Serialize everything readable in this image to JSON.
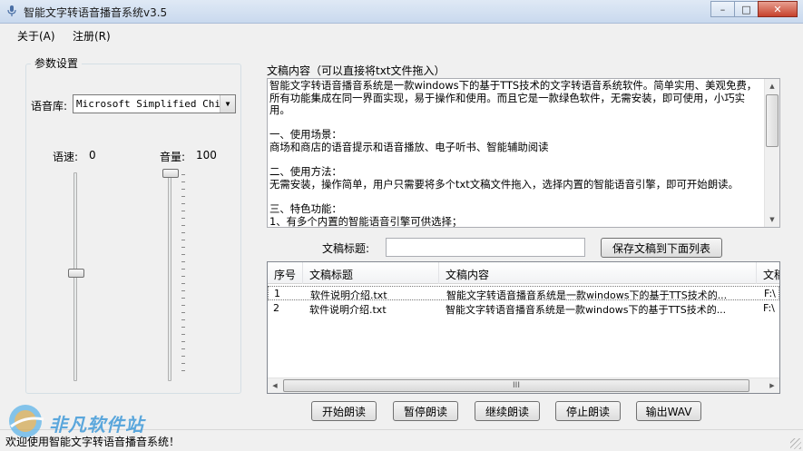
{
  "window": {
    "title": "智能文字转语音播音系统v3.5",
    "min_glyph": "–",
    "max_glyph": "□",
    "close_glyph": "✕"
  },
  "menu": {
    "about": "关于(A)",
    "register": "注册(R)"
  },
  "params": {
    "group_title": "参数设置",
    "voice_label": "语音库:",
    "voice_value": "Microsoft Simplified Chine",
    "speed_label": "语速:",
    "speed_value": "0",
    "volume_label": "音量:",
    "volume_value": "100",
    "speed_level_fraction": 0.5,
    "volume_level_fraction": 1.0
  },
  "editor": {
    "label": "文稿内容（可以直接将txt文件拖入）",
    "content": "智能文字转语音播音系统是一款windows下的基于TTS技术的文字转语音系统软件。简单实用、美观免费，所有功能集成在同一界面实现，易于操作和使用。而且它是一款绿色软件，无需安装，即可使用，小巧实用。\n\n一、使用场景：\n商场和商店的语音提示和语音播放、电子听书、智能辅助阅读\n\n二、使用方法：\n无需安装，操作简单，用户只需要将多个txt文稿文件拖入，选择内置的智能语音引擎，即可开始朗读。\n\n三、特色功能：\n1、有多个内置的智能语音引擎可供选择；"
  },
  "title_field": {
    "label": "文稿标题:",
    "value": "",
    "save_button": "保存文稿到下面列表"
  },
  "list": {
    "columns": [
      "序号",
      "文稿标题",
      "文稿内容",
      "文稿"
    ],
    "rows": [
      {
        "index": "1",
        "title": "软件说明介绍.txt",
        "content": "智能文字转语音播音系统是一款windows下的基于TTS技术的...",
        "path": "F:\\"
      },
      {
        "index": "2",
        "title": "软件说明介绍.txt",
        "content": "智能文字转语音播音系统是一款windows下的基于TTS技术的...",
        "path": "F:\\"
      }
    ],
    "scroll_grip": "III"
  },
  "buttons": {
    "start": "开始朗读",
    "pause": "暂停朗读",
    "resume": "继续朗读",
    "stop": "停止朗读",
    "export": "输出WAV"
  },
  "status": {
    "text": "欢迎使用智能文字转语音播音系统！"
  },
  "watermark": {
    "text": "非凡软件站"
  },
  "colors": {
    "titlebar": "#c9d9ee",
    "close": "#c6412c",
    "watermark": "#2a8fd6"
  }
}
